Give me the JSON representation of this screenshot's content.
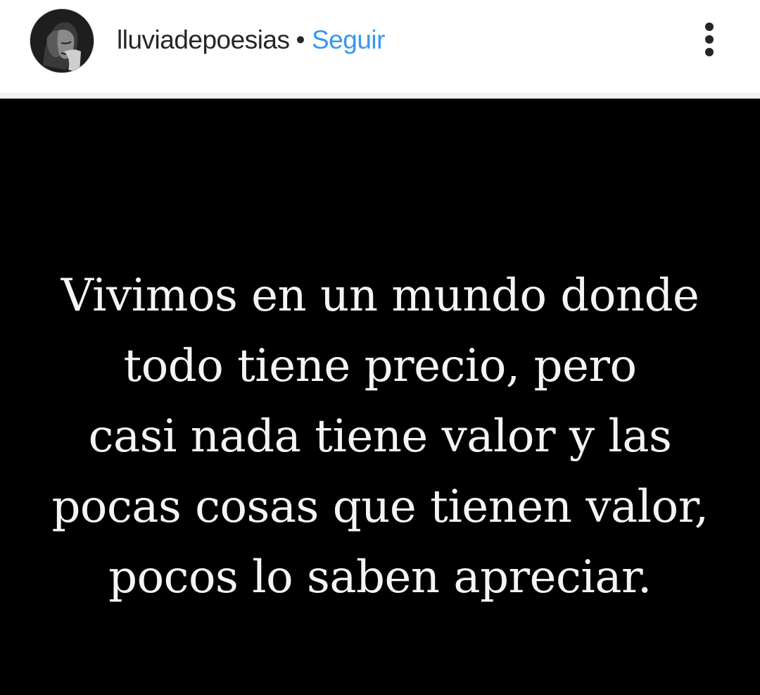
{
  "header": {
    "username": "lluviadepoesias",
    "separator": "•",
    "follow_label": "Seguir",
    "avatar_icon": "profile-avatar",
    "more_icon": "more-options-icon"
  },
  "post": {
    "background_color": "#000000",
    "quote_lines": [
      "Vivimos en un mundo donde",
      "todo tiene precio, pero",
      "casi nada tiene valor y las",
      "pocas cosas que tienen valor,",
      "pocos lo saben apreciar."
    ]
  },
  "colors": {
    "follow": "#3897f0",
    "text": "#262626"
  }
}
